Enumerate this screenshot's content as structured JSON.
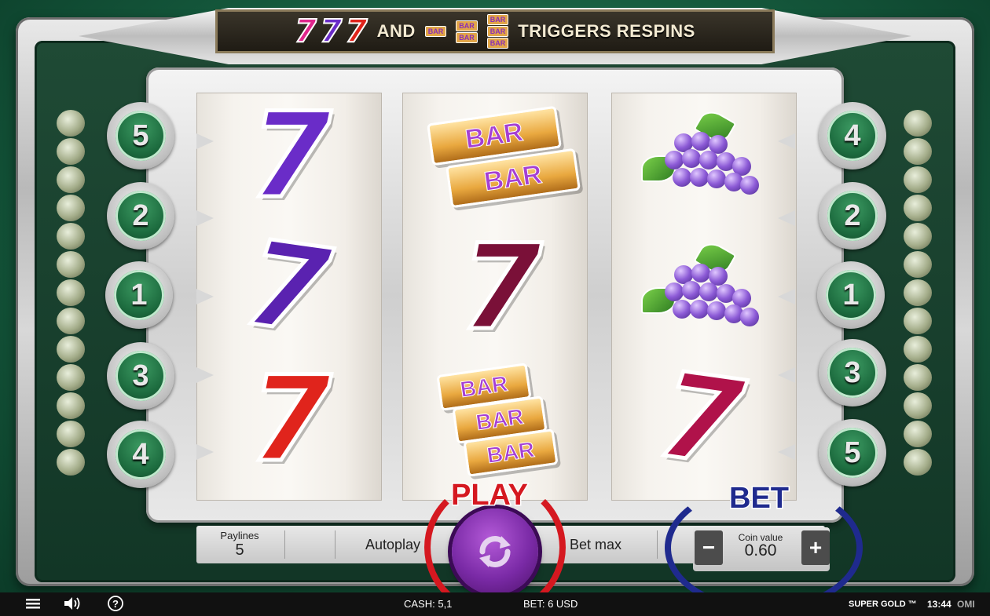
{
  "banner": {
    "sevens": [
      "7",
      "7",
      "7"
    ],
    "and_text": "AND",
    "bar_icons": [
      [
        "BAR"
      ],
      [
        "BAR",
        "BAR"
      ],
      [
        "BAR",
        "BAR",
        "BAR"
      ]
    ],
    "trigger_text": "TRIGGERS RESPINS"
  },
  "paylines": {
    "left": [
      "5",
      "2",
      "1",
      "3",
      "4"
    ],
    "right": [
      "4",
      "2",
      "1",
      "3",
      "5"
    ]
  },
  "reels": [
    {
      "symbols": [
        "purple-seven",
        "purple-seven",
        "red-seven"
      ]
    },
    {
      "symbols": [
        "double-bar",
        "maroon-seven",
        "triple-bar"
      ]
    },
    {
      "symbols": [
        "grapes",
        "grapes",
        "crimson-seven"
      ]
    }
  ],
  "symbol_labels": {
    "seven": "7",
    "bar": "BAR"
  },
  "colors": {
    "purple_seven": "#6a2cc8",
    "red_seven": "#e0241c",
    "maroon_seven": "#7a1038",
    "crimson_seven": "#b0124a",
    "play_annotation": "#d51820",
    "bet_annotation": "#1f2a8e"
  },
  "controls": {
    "paylines_label": "Paylines",
    "paylines_value": "5",
    "autoplay_label": "Autoplay",
    "bet_max_label": "Bet max",
    "coin_value_label": "Coin value",
    "coin_value": "0.60",
    "minus": "−",
    "plus": "+"
  },
  "annotations": {
    "play": "PLAY",
    "bet": "BET"
  },
  "status": {
    "cash": "CASH: 5,1",
    "bet": "BET: 6 USD",
    "game_title": "SUPER GOLD ™",
    "time": "13:44",
    "brand": "OMI"
  },
  "icons": [
    "menu-icon",
    "sound-icon",
    "help-icon",
    "spin-icon"
  ]
}
